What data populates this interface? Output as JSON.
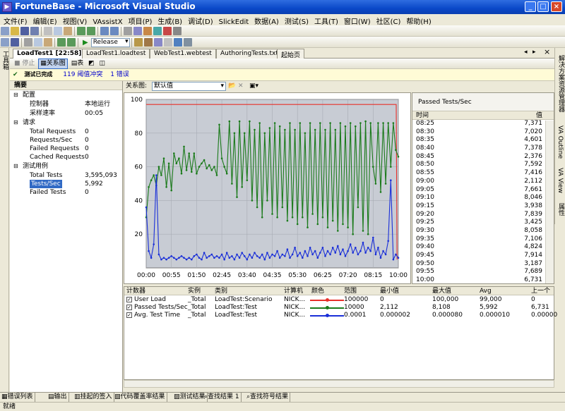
{
  "window": {
    "title": "FortuneBase - Microsoft Visual Studio",
    "accent": "#0a48c8"
  },
  "menu": [
    "文件(F)",
    "编辑(E)",
    "视图(V)",
    "VAssistX",
    "项目(P)",
    "生成(B)",
    "调试(D)",
    "SlickEdit",
    "数据(A)",
    "测试(S)",
    "工具(T)",
    "窗口(W)",
    "社区(C)",
    "帮助(H)"
  ],
  "toolbar": {
    "configuration": "Release"
  },
  "left_strip": {
    "label": "工具箱"
  },
  "right_strip": {
    "labels": [
      "解决方案资源管理器",
      "VA Outline",
      "VA View",
      "属性"
    ]
  },
  "doc_tabs": [
    "LoadTest1 [22:58]",
    "LoadTest1.loadtest",
    "WebTest1.webtest",
    "AuthoringTests.txt",
    "起始页"
  ],
  "doc_toolbar": {
    "stop": "停止",
    "graphs": "关系图",
    "tables": "表"
  },
  "info_bar": {
    "status": "测试已完成",
    "thresholds": "119 阈值冲突",
    "errors": "1 错误"
  },
  "summary": {
    "title": "摘要",
    "config": {
      "label": "配置",
      "controller_label": "控制器",
      "controller_value": "本地运行",
      "sample_rate_label": "采样速率",
      "sample_rate_value": "00:05"
    },
    "requests": {
      "label": "请求",
      "rows": [
        {
          "k": "Total Requests",
          "v": "0"
        },
        {
          "k": "Requests/Sec",
          "v": "0"
        },
        {
          "k": "Failed Requests",
          "v": "0"
        },
        {
          "k": "Cached Requests",
          "v": "0"
        }
      ]
    },
    "tests": {
      "label": "测试用例",
      "rows": [
        {
          "k": "Total Tests",
          "v": "3,595,093"
        },
        {
          "k": "Tests/Sec",
          "v": "5,992"
        },
        {
          "k": "Failed Tests",
          "v": "0"
        }
      ]
    }
  },
  "graph": {
    "label": "关系图:",
    "selected": "默认值"
  },
  "chart_data": {
    "type": "line",
    "ylim": [
      0,
      100
    ],
    "yticks": [
      20,
      40,
      60,
      80,
      100
    ],
    "xticks": [
      "00:00",
      "00:55",
      "01:50",
      "02:45",
      "03:40",
      "04:35",
      "05:30",
      "06:25",
      "07:20",
      "08:15",
      "10:00"
    ],
    "xlim": [
      0,
      600
    ],
    "grid": true,
    "series": [
      {
        "name": "User Load",
        "color": "#e8302a",
        "points": [
          [
            0,
            97
          ],
          [
            595,
            97
          ],
          [
            597,
            5
          ]
        ]
      },
      {
        "name": "Passed Tests/Sec",
        "color": "#1a7a1a",
        "points": [
          [
            0,
            30
          ],
          [
            6,
            48
          ],
          [
            12,
            52
          ],
          [
            18,
            55
          ],
          [
            24,
            49
          ],
          [
            30,
            60
          ],
          [
            36,
            55
          ],
          [
            42,
            65
          ],
          [
            48,
            48
          ],
          [
            54,
            62
          ],
          [
            60,
            46
          ],
          [
            66,
            68
          ],
          [
            72,
            62
          ],
          [
            78,
            65
          ],
          [
            84,
            56
          ],
          [
            90,
            72
          ],
          [
            96,
            58
          ],
          [
            102,
            68
          ],
          [
            108,
            57
          ],
          [
            114,
            68
          ],
          [
            120,
            56
          ],
          [
            126,
            60
          ],
          [
            132,
            62
          ],
          [
            138,
            64
          ],
          [
            144,
            59
          ],
          [
            150,
            61
          ],
          [
            156,
            58
          ],
          [
            162,
            60
          ],
          [
            168,
            55
          ],
          [
            174,
            85
          ],
          [
            180,
            65
          ],
          [
            186,
            60
          ],
          [
            192,
            56
          ],
          [
            198,
            87
          ],
          [
            204,
            50
          ],
          [
            210,
            80
          ],
          [
            216,
            42
          ],
          [
            222,
            87
          ],
          [
            228,
            48
          ],
          [
            234,
            80
          ],
          [
            240,
            52
          ],
          [
            246,
            87
          ],
          [
            252,
            40
          ],
          [
            258,
            82
          ],
          [
            264,
            36
          ],
          [
            270,
            86
          ],
          [
            276,
            30
          ],
          [
            282,
            80
          ],
          [
            288,
            40
          ],
          [
            294,
            83
          ],
          [
            300,
            32
          ],
          [
            306,
            86
          ],
          [
            312,
            30
          ],
          [
            318,
            84
          ],
          [
            324,
            36
          ],
          [
            330,
            82
          ],
          [
            336,
            28
          ],
          [
            342,
            86
          ],
          [
            348,
            30
          ],
          [
            354,
            82
          ],
          [
            360,
            26
          ],
          [
            366,
            86
          ],
          [
            372,
            30
          ],
          [
            378,
            80
          ],
          [
            384,
            24
          ],
          [
            390,
            86
          ],
          [
            396,
            32
          ],
          [
            402,
            82
          ],
          [
            408,
            26
          ],
          [
            414,
            86
          ],
          [
            420,
            30
          ],
          [
            426,
            82
          ],
          [
            432,
            24
          ],
          [
            438,
            86
          ],
          [
            444,
            28
          ],
          [
            450,
            82
          ],
          [
            456,
            22
          ],
          [
            462,
            86
          ],
          [
            468,
            26
          ],
          [
            474,
            84
          ],
          [
            480,
            24
          ],
          [
            486,
            86
          ],
          [
            492,
            20
          ],
          [
            498,
            84
          ],
          [
            504,
            36
          ],
          [
            510,
            86
          ],
          [
            516,
            22
          ],
          [
            522,
            87
          ],
          [
            528,
            20
          ],
          [
            534,
            86
          ],
          [
            540,
            60
          ],
          [
            546,
            50
          ],
          [
            552,
            86
          ],
          [
            558,
            45
          ],
          [
            564,
            86
          ],
          [
            570,
            50
          ],
          [
            576,
            86
          ],
          [
            582,
            60
          ],
          [
            588,
            86
          ],
          [
            594,
            70
          ],
          [
            600,
            66
          ]
        ]
      },
      {
        "name": "Avg. Test Time",
        "color": "#1a2fd8",
        "points": [
          [
            0,
            36
          ],
          [
            6,
            10
          ],
          [
            12,
            6
          ],
          [
            18,
            14
          ],
          [
            24,
            55
          ],
          [
            30,
            8
          ],
          [
            36,
            5
          ],
          [
            42,
            6
          ],
          [
            48,
            5
          ],
          [
            54,
            6
          ],
          [
            60,
            7
          ],
          [
            66,
            6
          ],
          [
            72,
            5
          ],
          [
            78,
            6
          ],
          [
            84,
            7
          ],
          [
            90,
            6
          ],
          [
            96,
            5
          ],
          [
            102,
            6
          ],
          [
            108,
            5
          ],
          [
            114,
            7
          ],
          [
            120,
            8
          ],
          [
            126,
            6
          ],
          [
            132,
            5
          ],
          [
            138,
            9
          ],
          [
            144,
            6
          ],
          [
            150,
            7
          ],
          [
            156,
            8
          ],
          [
            162,
            6
          ],
          [
            168,
            7
          ],
          [
            174,
            6
          ],
          [
            180,
            8
          ],
          [
            186,
            5
          ],
          [
            192,
            9
          ],
          [
            198,
            6
          ],
          [
            204,
            7
          ],
          [
            210,
            5
          ],
          [
            216,
            8
          ],
          [
            222,
            6
          ],
          [
            228,
            9
          ],
          [
            234,
            7
          ],
          [
            240,
            5
          ],
          [
            246,
            8
          ],
          [
            252,
            6
          ],
          [
            258,
            9
          ],
          [
            264,
            7
          ],
          [
            270,
            6
          ],
          [
            276,
            8
          ],
          [
            282,
            5
          ],
          [
            288,
            9
          ],
          [
            294,
            6
          ],
          [
            300,
            8
          ],
          [
            306,
            7
          ],
          [
            312,
            10
          ],
          [
            318,
            6
          ],
          [
            324,
            8
          ],
          [
            330,
            7
          ],
          [
            336,
            11
          ],
          [
            342,
            6
          ],
          [
            348,
            8
          ],
          [
            354,
            12
          ],
          [
            360,
            7
          ],
          [
            366,
            9
          ],
          [
            372,
            6
          ],
          [
            378,
            10
          ],
          [
            384,
            7
          ],
          [
            390,
            12
          ],
          [
            396,
            8
          ],
          [
            402,
            10
          ],
          [
            408,
            6
          ],
          [
            414,
            9
          ],
          [
            420,
            12
          ],
          [
            426,
            7
          ],
          [
            432,
            10
          ],
          [
            438,
            8
          ],
          [
            444,
            12
          ],
          [
            450,
            9
          ],
          [
            456,
            13
          ],
          [
            462,
            8
          ],
          [
            468,
            11
          ],
          [
            474,
            7
          ],
          [
            480,
            10
          ],
          [
            486,
            14
          ],
          [
            492,
            9
          ],
          [
            498,
            12
          ],
          [
            504,
            8
          ],
          [
            510,
            10
          ],
          [
            516,
            15
          ],
          [
            522,
            9
          ],
          [
            528,
            12
          ],
          [
            534,
            10
          ],
          [
            540,
            18
          ],
          [
            546,
            8
          ],
          [
            552,
            12
          ],
          [
            558,
            6
          ],
          [
            564,
            10
          ],
          [
            570,
            8
          ],
          [
            576,
            16
          ],
          [
            582,
            52
          ],
          [
            588,
            5
          ],
          [
            594,
            8
          ],
          [
            600,
            6
          ]
        ]
      }
    ]
  },
  "passed_table": {
    "title": "Passed Tests/Sec",
    "col_time": "时间",
    "col_value": "值",
    "rows": [
      [
        "08:25",
        "7,371"
      ],
      [
        "08:30",
        "7,020"
      ],
      [
        "08:35",
        "4,601"
      ],
      [
        "08:40",
        "7,378"
      ],
      [
        "08:45",
        "2,376"
      ],
      [
        "08:50",
        "7,592"
      ],
      [
        "08:55",
        "7,416"
      ],
      [
        "09:00",
        "2,112"
      ],
      [
        "09:05",
        "7,661"
      ],
      [
        "09:10",
        "8,046"
      ],
      [
        "09:15",
        "3,938"
      ],
      [
        "09:20",
        "7,839"
      ],
      [
        "09:25",
        "3,425"
      ],
      [
        "09:30",
        "8,058"
      ],
      [
        "09:35",
        "7,106"
      ],
      [
        "09:40",
        "4,824"
      ],
      [
        "09:45",
        "7,914"
      ],
      [
        "09:50",
        "3,187"
      ],
      [
        "09:55",
        "7,689"
      ],
      [
        "10:00",
        "6,731"
      ]
    ]
  },
  "counters": {
    "headers": [
      "计数器",
      "实例",
      "类别",
      "计算机",
      "颜色",
      "范围",
      "最小值",
      "最大值",
      "Avg",
      "上一个"
    ],
    "rows": [
      {
        "name": "User Load",
        "instance": "_Total",
        "category": "LoadTest:Scenario",
        "computer": "NICK...",
        "color": "#e8302a",
        "range": "100000",
        "min": "0",
        "max": "100,000",
        "avg": "99,000",
        "last": "0"
      },
      {
        "name": "Passed Tests/Sec",
        "instance": "_Total",
        "category": "LoadTest:Test",
        "computer": "NICK...",
        "color": "#1a7a1a",
        "range": "10000",
        "min": "2,112",
        "max": "8,108",
        "avg": "5,992",
        "last": "6,731"
      },
      {
        "name": "Avg. Test Time",
        "instance": "_Total",
        "category": "LoadTest:Test",
        "computer": "NICK...",
        "color": "#1a2fd8",
        "range": "0.0001",
        "min": "0.000002",
        "max": "0.000080",
        "avg": "0.000010",
        "last": "0.00000"
      }
    ]
  },
  "bottom_tabs": [
    "错误列表",
    "输出",
    "挂起的签入",
    "代码覆盖率结果",
    "测试结果",
    "查找结果 1",
    "查找符号结果"
  ],
  "status": "就绪"
}
